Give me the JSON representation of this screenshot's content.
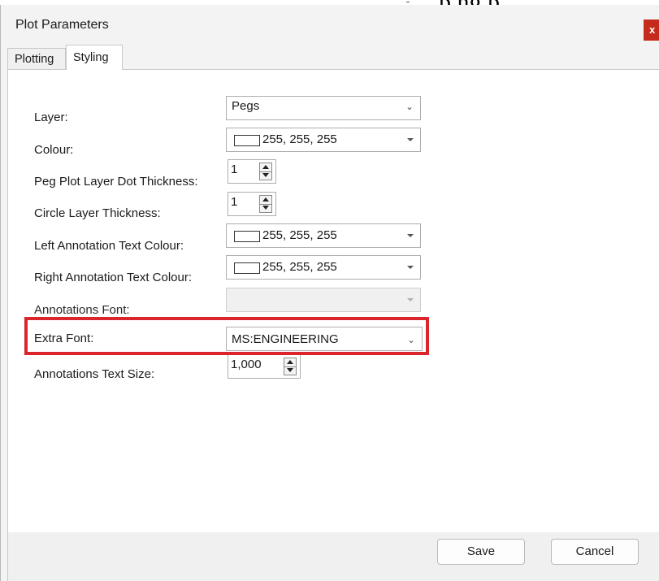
{
  "background_app": {
    "text": "p ng p"
  },
  "window": {
    "title": "Plot Parameters",
    "close_label": "x"
  },
  "tabs": [
    {
      "label": "Plotting",
      "active": false
    },
    {
      "label": "Styling",
      "active": true
    }
  ],
  "fields": {
    "layer": {
      "label": "Layer:",
      "value": "Pegs"
    },
    "colour": {
      "label": "Colour:",
      "value": "255, 255, 255",
      "swatch_color": "#ffffff"
    },
    "peg_dot_thickness": {
      "label": "Peg Plot Layer Dot Thickness:",
      "value": "1"
    },
    "circle_thickness": {
      "label": "Circle Layer Thickness:",
      "value": "1"
    },
    "left_annotation_colour": {
      "label": "Left Annotation Text Colour:",
      "value": "255, 255, 255",
      "swatch_color": "#ffffff"
    },
    "right_annotation_colour": {
      "label": "Right Annotation Text Colour:",
      "value": "255, 255, 255",
      "swatch_color": "#ffffff"
    },
    "annotations_font": {
      "label": "Annotations Font:",
      "value": "",
      "enabled": false
    },
    "extra_font": {
      "label": "Extra Font:",
      "value": "MS:ENGINEERING",
      "highlighted": true
    },
    "annotations_text_size": {
      "label": "Annotations Text Size:",
      "value": "1,000"
    }
  },
  "buttons": {
    "save_label": "Save",
    "cancel_label": "Cancel"
  },
  "colors": {
    "highlight": "#d9252b",
    "close_button": "#c42b1c"
  }
}
